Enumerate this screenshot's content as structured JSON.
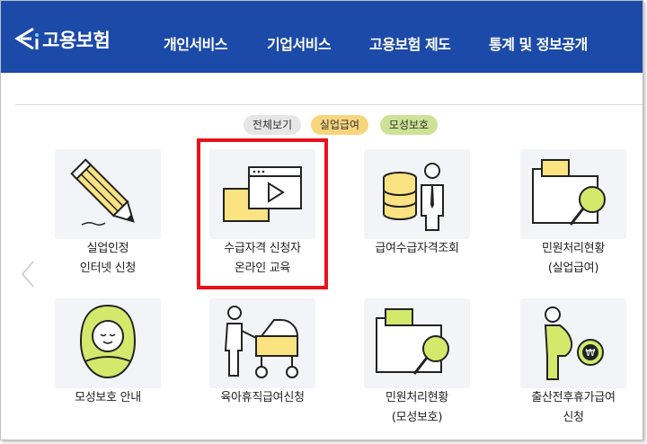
{
  "header": {
    "logo_text": "고용보험",
    "nav": [
      "개인서비스",
      "기업서비스",
      "고용보험 제도",
      "통계 및 정보공개"
    ]
  },
  "filters": [
    {
      "label": "전체보기",
      "color": "#e6e6e6"
    },
    {
      "label": "실업급여",
      "color": "#f7d57c"
    },
    {
      "label": "모성보호",
      "color": "#cde295"
    }
  ],
  "services": [
    {
      "line1": "실업인정",
      "line2": "인터넷 신청",
      "icon": "pencil-icon"
    },
    {
      "line1": "수급자격 신청자",
      "line2": "온라인 교육",
      "icon": "video-play-icon"
    },
    {
      "line1": "급여수급자격조회",
      "line2": "",
      "icon": "database-person-icon"
    },
    {
      "line1": "민원처리현황",
      "line2": "(실업급여)",
      "icon": "folder-search-icon"
    },
    {
      "line1": "모성보호 안내",
      "line2": "",
      "icon": "baby-icon"
    },
    {
      "line1": "육아휴직급여신청",
      "line2": "",
      "icon": "stroller-icon"
    },
    {
      "line1": "민원처리현황",
      "line2": "(모성보호)",
      "icon": "folder-search-icon"
    },
    {
      "line1": "출산전후휴가급여",
      "line2": "신청",
      "icon": "pregnant-won-icon"
    }
  ],
  "colors": {
    "header": "#1c4aa8",
    "highlight": "#e8121b",
    "accent_yellow": "#fbe382",
    "accent_green": "#b6d83a"
  }
}
